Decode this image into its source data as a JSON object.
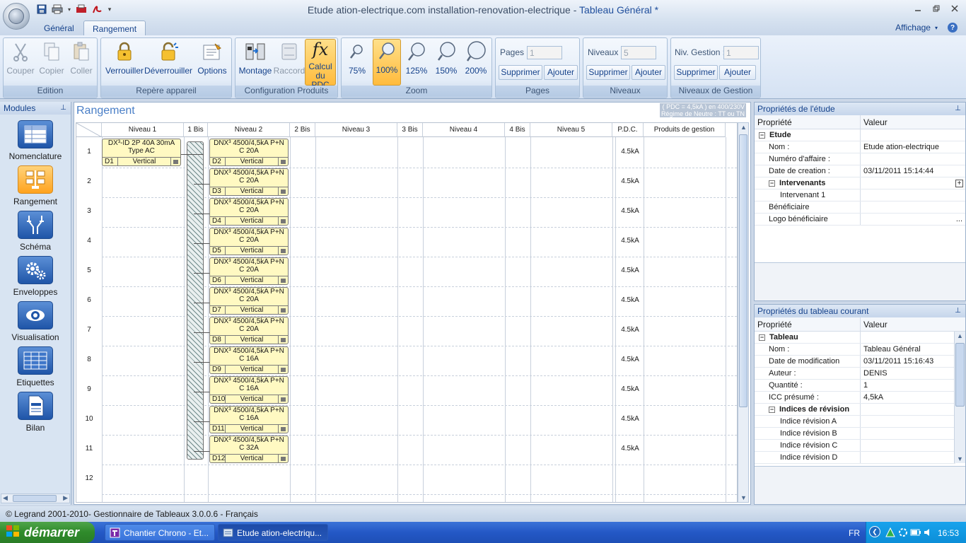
{
  "window": {
    "title_main": "Etude ation-electrique.com installation-renovation-electrique - ",
    "title_doc": "Tableau Général *"
  },
  "ribbon_tabs": [
    {
      "label": "Général"
    },
    {
      "label": "Rangement"
    }
  ],
  "view_menu": "Affichage",
  "help": "?",
  "ribbon": {
    "edition": {
      "label": "Edition",
      "couper": "Couper",
      "copier": "Copier",
      "coller": "Coller"
    },
    "repere": {
      "label": "Repère appareil",
      "verrouiller": "Verrouiller",
      "deverrouiller": "Déverrouiller",
      "options": "Options"
    },
    "config": {
      "label": "Configuration Produits",
      "montage": "Montage",
      "raccord": "Raccord",
      "calcul_1": "Calcul",
      "calcul_2": "du PDC"
    },
    "zoom": {
      "label": "Zoom",
      "levels": [
        "75%",
        "100%",
        "125%",
        "150%",
        "200%"
      ]
    },
    "pages": {
      "label": "Pages",
      "field_label": "Pages :",
      "value": "1",
      "supprimer": "Supprimer",
      "ajouter": "Ajouter"
    },
    "niveaux": {
      "label": "Niveaux",
      "field_label": "Niveaux :",
      "value": "5",
      "supprimer": "Supprimer",
      "ajouter": "Ajouter"
    },
    "gestion": {
      "label": "Niveaux de Gestion",
      "field_label": "Niv. Gestion :",
      "value": "1",
      "supprimer": "Supprimer",
      "ajouter": "Ajouter"
    }
  },
  "modules": {
    "title": "Modules",
    "items": [
      {
        "label": "Nomenclature",
        "icon": "list-icon"
      },
      {
        "label": "Rangement",
        "icon": "layout-icon"
      },
      {
        "label": "Schéma",
        "icon": "schema-icon"
      },
      {
        "label": "Enveloppes",
        "icon": "gears-icon"
      },
      {
        "label": "Visualisation",
        "icon": "eye-icon"
      },
      {
        "label": "Etiquettes",
        "icon": "table-icon"
      },
      {
        "label": "Bilan",
        "icon": "document-icon"
      }
    ]
  },
  "rangement": {
    "title": "Rangement",
    "info_line1": "( PDC = 4,5kA ) en 400/230V",
    "info_line2": "Régime de Neutre : TT ou TN",
    "columns": [
      "Niveau 1",
      "1 Bis",
      "Niveau 2",
      "2 Bis",
      "Niveau 3",
      "3 Bis",
      "Niveau 4",
      "4 Bis",
      "Niveau 5",
      "P.D.C.",
      "Produits de gestion"
    ],
    "rows": [
      "1",
      "2",
      "3",
      "4",
      "5",
      "6",
      "7",
      "8",
      "9",
      "10",
      "11",
      "12"
    ],
    "pdc": [
      "4.5kA",
      "4.5kA",
      "4.5kA",
      "4.5kA",
      "4.5kA",
      "4.5kA",
      "4.5kA",
      "4.5kA",
      "4.5kA",
      "4.5kA",
      "4.5kA"
    ],
    "devices": [
      {
        "l1": "DX³-ID 2P 40A 30mA",
        "l2": "Type AC",
        "id": "D1",
        "orient": "Vertical"
      },
      {
        "l1": "DNX³ 4500/4,5kA P+N",
        "l2": "C 20A",
        "id": "D2",
        "orient": "Vertical"
      },
      {
        "l1": "DNX³ 4500/4,5kA P+N",
        "l2": "C 20A",
        "id": "D3",
        "orient": "Vertical"
      },
      {
        "l1": "DNX³ 4500/4,5kA P+N",
        "l2": "C 20A",
        "id": "D4",
        "orient": "Vertical"
      },
      {
        "l1": "DNX³ 4500/4,5kA P+N",
        "l2": "C 20A",
        "id": "D5",
        "orient": "Vertical"
      },
      {
        "l1": "DNX³ 4500/4,5kA P+N",
        "l2": "C 20A",
        "id": "D6",
        "orient": "Vertical"
      },
      {
        "l1": "DNX³ 4500/4,5kA P+N",
        "l2": "C 20A",
        "id": "D7",
        "orient": "Vertical"
      },
      {
        "l1": "DNX³ 4500/4,5kA P+N",
        "l2": "C 20A",
        "id": "D8",
        "orient": "Vertical"
      },
      {
        "l1": "DNX³ 4500/4,5kA P+N",
        "l2": "C 16A",
        "id": "D9",
        "orient": "Vertical"
      },
      {
        "l1": "DNX³ 4500/4,5kA P+N",
        "l2": "C 16A",
        "id": "D10",
        "orient": "Vertical"
      },
      {
        "l1": "DNX³ 4500/4,5kA P+N",
        "l2": "C 16A",
        "id": "D11",
        "orient": "Vertical"
      },
      {
        "l1": "DNX³ 4500/4,5kA P+N",
        "l2": "C 32A",
        "id": "D12",
        "orient": "Vertical"
      }
    ]
  },
  "props_etude": {
    "title": "Propriétés de l'étude",
    "col_prop": "Propriété",
    "col_val": "Valeur",
    "rows": [
      {
        "k": "Etude",
        "v": "",
        "level": 0,
        "cat": true,
        "toggle": "−"
      },
      {
        "k": "Nom :",
        "v": "Etude ation-electrique",
        "level": 1
      },
      {
        "k": "Numéro d'affaire :",
        "v": "",
        "level": 1
      },
      {
        "k": "Date de creation :",
        "v": "03/11/2011 15:14:44",
        "level": 1
      },
      {
        "k": "Intervenants",
        "v": "",
        "level": 1,
        "cat": true,
        "toggle": "−"
      },
      {
        "k": "Intervenant 1",
        "v": "",
        "level": 2
      },
      {
        "k": "Bénéficiaire",
        "v": "",
        "level": 1
      },
      {
        "k": "Logo bénéficiaire",
        "v": "...",
        "level": 1
      }
    ]
  },
  "props_tableau": {
    "title": "Propriétés du tableau courant",
    "col_prop": "Propriété",
    "col_val": "Valeur",
    "rows": [
      {
        "k": "Tableau",
        "v": "",
        "level": 0,
        "cat": true,
        "toggle": "−"
      },
      {
        "k": "Nom :",
        "v": "Tableau Général",
        "level": 1
      },
      {
        "k": "Date de modification",
        "v": "03/11/2011 15:16:43",
        "level": 1
      },
      {
        "k": "Auteur :",
        "v": "DENIS",
        "level": 1
      },
      {
        "k": "Quantité :",
        "v": "1",
        "level": 1
      },
      {
        "k": "ICC présumé :",
        "v": "4,5kA",
        "level": 1
      },
      {
        "k": "Indices de révision",
        "v": "",
        "level": 1,
        "cat": true,
        "toggle": "−"
      },
      {
        "k": "Indice révision A",
        "v": "",
        "level": 2
      },
      {
        "k": "Indice révision B",
        "v": "",
        "level": 2
      },
      {
        "k": "Indice révision C",
        "v": "",
        "level": 2
      },
      {
        "k": "Indice révision D",
        "v": "",
        "level": 2
      }
    ]
  },
  "status": "© Legrand 2001-2010- Gestionnaire de Tableaux 3.0.0.6 - Français",
  "taskbar": {
    "start": "démarrer",
    "tasks": [
      {
        "label": "Chantier Chrono - Et..."
      },
      {
        "label": "Etude ation-electriqu..."
      }
    ],
    "lang": "FR",
    "clock": "16:53"
  }
}
